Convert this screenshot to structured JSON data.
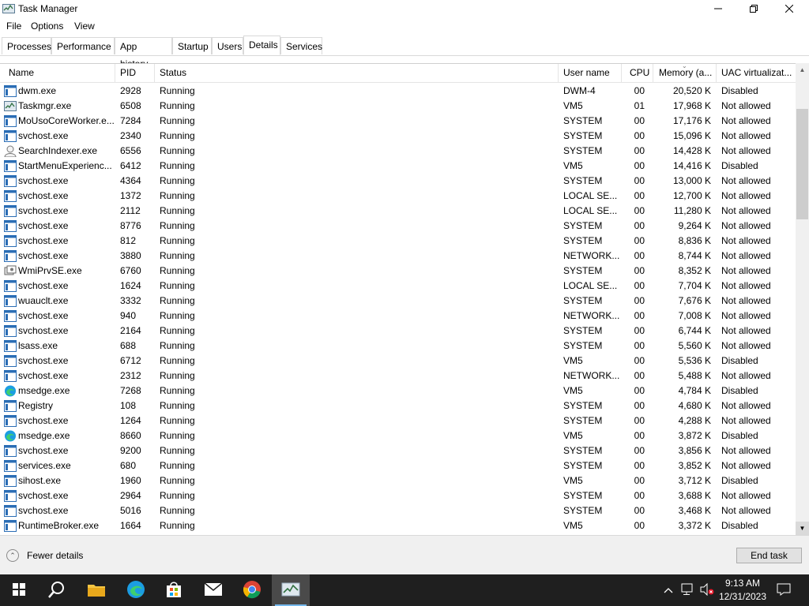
{
  "window": {
    "title": "Task Manager",
    "icon": "task-manager-icon",
    "controls": [
      "minimize-icon",
      "maximize-icon",
      "close-icon"
    ]
  },
  "menu": [
    "File",
    "Options",
    "View"
  ],
  "tabs": [
    {
      "label": "Processes",
      "active": false
    },
    {
      "label": "Performance",
      "active": false
    },
    {
      "label": "App history",
      "active": false
    },
    {
      "label": "Startup",
      "active": false
    },
    {
      "label": "Users",
      "active": false
    },
    {
      "label": "Details",
      "active": true
    },
    {
      "label": "Services",
      "active": false
    }
  ],
  "columns": {
    "name": "Name",
    "pid": "PID",
    "status": "Status",
    "user": "User name",
    "cpu": "CPU",
    "memory": "Memory (a...",
    "uac": "UAC virtualizat..."
  },
  "rows": [
    {
      "icon": "window-app-icon",
      "name": "dwm.exe",
      "pid": "2928",
      "status": "Running",
      "user": "DWM-4",
      "cpu": "00",
      "memory": "20,520 K",
      "uac": "Disabled"
    },
    {
      "icon": "task-manager-icon",
      "name": "Taskmgr.exe",
      "pid": "6508",
      "status": "Running",
      "user": "VM5",
      "cpu": "01",
      "memory": "17,968 K",
      "uac": "Not allowed"
    },
    {
      "icon": "window-app-icon",
      "name": "MoUsoCoreWorker.e...",
      "pid": "7284",
      "status": "Running",
      "user": "SYSTEM",
      "cpu": "00",
      "memory": "17,176 K",
      "uac": "Not allowed"
    },
    {
      "icon": "window-app-icon",
      "name": "svchost.exe",
      "pid": "2340",
      "status": "Running",
      "user": "SYSTEM",
      "cpu": "00",
      "memory": "15,096 K",
      "uac": "Not allowed"
    },
    {
      "icon": "search-indexer-icon",
      "name": "SearchIndexer.exe",
      "pid": "6556",
      "status": "Running",
      "user": "SYSTEM",
      "cpu": "00",
      "memory": "14,428 K",
      "uac": "Not allowed"
    },
    {
      "icon": "window-app-icon",
      "name": "StartMenuExperienc...",
      "pid": "6412",
      "status": "Running",
      "user": "VM5",
      "cpu": "00",
      "memory": "14,416 K",
      "uac": "Disabled"
    },
    {
      "icon": "window-app-icon",
      "name": "svchost.exe",
      "pid": "4364",
      "status": "Running",
      "user": "SYSTEM",
      "cpu": "00",
      "memory": "13,000 K",
      "uac": "Not allowed"
    },
    {
      "icon": "window-app-icon",
      "name": "svchost.exe",
      "pid": "1372",
      "status": "Running",
      "user": "LOCAL SE...",
      "cpu": "00",
      "memory": "12,700 K",
      "uac": "Not allowed"
    },
    {
      "icon": "window-app-icon",
      "name": "svchost.exe",
      "pid": "2112",
      "status": "Running",
      "user": "LOCAL SE...",
      "cpu": "00",
      "memory": "11,280 K",
      "uac": "Not allowed"
    },
    {
      "icon": "window-app-icon",
      "name": "svchost.exe",
      "pid": "8776",
      "status": "Running",
      "user": "SYSTEM",
      "cpu": "00",
      "memory": "9,264 K",
      "uac": "Not allowed"
    },
    {
      "icon": "window-app-icon",
      "name": "svchost.exe",
      "pid": "812",
      "status": "Running",
      "user": "SYSTEM",
      "cpu": "00",
      "memory": "8,836 K",
      "uac": "Not allowed"
    },
    {
      "icon": "window-app-icon",
      "name": "svchost.exe",
      "pid": "3880",
      "status": "Running",
      "user": "NETWORK...",
      "cpu": "00",
      "memory": "8,744 K",
      "uac": "Not allowed"
    },
    {
      "icon": "wmi-icon",
      "name": "WmiPrvSE.exe",
      "pid": "6760",
      "status": "Running",
      "user": "SYSTEM",
      "cpu": "00",
      "memory": "8,352 K",
      "uac": "Not allowed"
    },
    {
      "icon": "window-app-icon",
      "name": "svchost.exe",
      "pid": "1624",
      "status": "Running",
      "user": "LOCAL SE...",
      "cpu": "00",
      "memory": "7,704 K",
      "uac": "Not allowed"
    },
    {
      "icon": "window-app-icon",
      "name": "wuauclt.exe",
      "pid": "3332",
      "status": "Running",
      "user": "SYSTEM",
      "cpu": "00",
      "memory": "7,676 K",
      "uac": "Not allowed"
    },
    {
      "icon": "window-app-icon",
      "name": "svchost.exe",
      "pid": "940",
      "status": "Running",
      "user": "NETWORK...",
      "cpu": "00",
      "memory": "7,008 K",
      "uac": "Not allowed"
    },
    {
      "icon": "window-app-icon",
      "name": "svchost.exe",
      "pid": "2164",
      "status": "Running",
      "user": "SYSTEM",
      "cpu": "00",
      "memory": "6,744 K",
      "uac": "Not allowed"
    },
    {
      "icon": "window-app-icon",
      "name": "lsass.exe",
      "pid": "688",
      "status": "Running",
      "user": "SYSTEM",
      "cpu": "00",
      "memory": "5,560 K",
      "uac": "Not allowed"
    },
    {
      "icon": "window-app-icon",
      "name": "svchost.exe",
      "pid": "6712",
      "status": "Running",
      "user": "VM5",
      "cpu": "00",
      "memory": "5,536 K",
      "uac": "Disabled"
    },
    {
      "icon": "window-app-icon",
      "name": "svchost.exe",
      "pid": "2312",
      "status": "Running",
      "user": "NETWORK...",
      "cpu": "00",
      "memory": "5,488 K",
      "uac": "Not allowed"
    },
    {
      "icon": "edge-icon",
      "name": "msedge.exe",
      "pid": "7268",
      "status": "Running",
      "user": "VM5",
      "cpu": "00",
      "memory": "4,784 K",
      "uac": "Disabled"
    },
    {
      "icon": "window-app-icon",
      "name": "Registry",
      "pid": "108",
      "status": "Running",
      "user": "SYSTEM",
      "cpu": "00",
      "memory": "4,680 K",
      "uac": "Not allowed"
    },
    {
      "icon": "window-app-icon",
      "name": "svchost.exe",
      "pid": "1264",
      "status": "Running",
      "user": "SYSTEM",
      "cpu": "00",
      "memory": "4,288 K",
      "uac": "Not allowed"
    },
    {
      "icon": "edge-icon",
      "name": "msedge.exe",
      "pid": "8660",
      "status": "Running",
      "user": "VM5",
      "cpu": "00",
      "memory": "3,872 K",
      "uac": "Disabled"
    },
    {
      "icon": "window-app-icon",
      "name": "svchost.exe",
      "pid": "9200",
      "status": "Running",
      "user": "SYSTEM",
      "cpu": "00",
      "memory": "3,856 K",
      "uac": "Not allowed"
    },
    {
      "icon": "window-app-icon",
      "name": "services.exe",
      "pid": "680",
      "status": "Running",
      "user": "SYSTEM",
      "cpu": "00",
      "memory": "3,852 K",
      "uac": "Not allowed"
    },
    {
      "icon": "window-app-icon",
      "name": "sihost.exe",
      "pid": "1960",
      "status": "Running",
      "user": "VM5",
      "cpu": "00",
      "memory": "3,712 K",
      "uac": "Disabled"
    },
    {
      "icon": "window-app-icon",
      "name": "svchost.exe",
      "pid": "2964",
      "status": "Running",
      "user": "SYSTEM",
      "cpu": "00",
      "memory": "3,688 K",
      "uac": "Not allowed"
    },
    {
      "icon": "window-app-icon",
      "name": "svchost.exe",
      "pid": "5016",
      "status": "Running",
      "user": "SYSTEM",
      "cpu": "00",
      "memory": "3,468 K",
      "uac": "Not allowed"
    },
    {
      "icon": "window-app-icon",
      "name": "RuntimeBroker.exe",
      "pid": "1664",
      "status": "Running",
      "user": "VM5",
      "cpu": "00",
      "memory": "3,372 K",
      "uac": "Disabled"
    }
  ],
  "footer": {
    "fewer_details": "Fewer details",
    "end_task": "End task"
  },
  "taskbar": {
    "apps": [
      "start-icon",
      "search-icon",
      "file-explorer-icon",
      "edge-icon",
      "store-icon",
      "mail-icon",
      "chrome-icon",
      "task-manager-icon"
    ],
    "tray_icons": [
      "chevron-up-icon",
      "network-icon",
      "volume-muted-icon",
      "notification-icon"
    ],
    "time": "9:13 AM",
    "date": "12/31/2023",
    "accent": "#76b9ed",
    "background": "#1f1f1f"
  }
}
